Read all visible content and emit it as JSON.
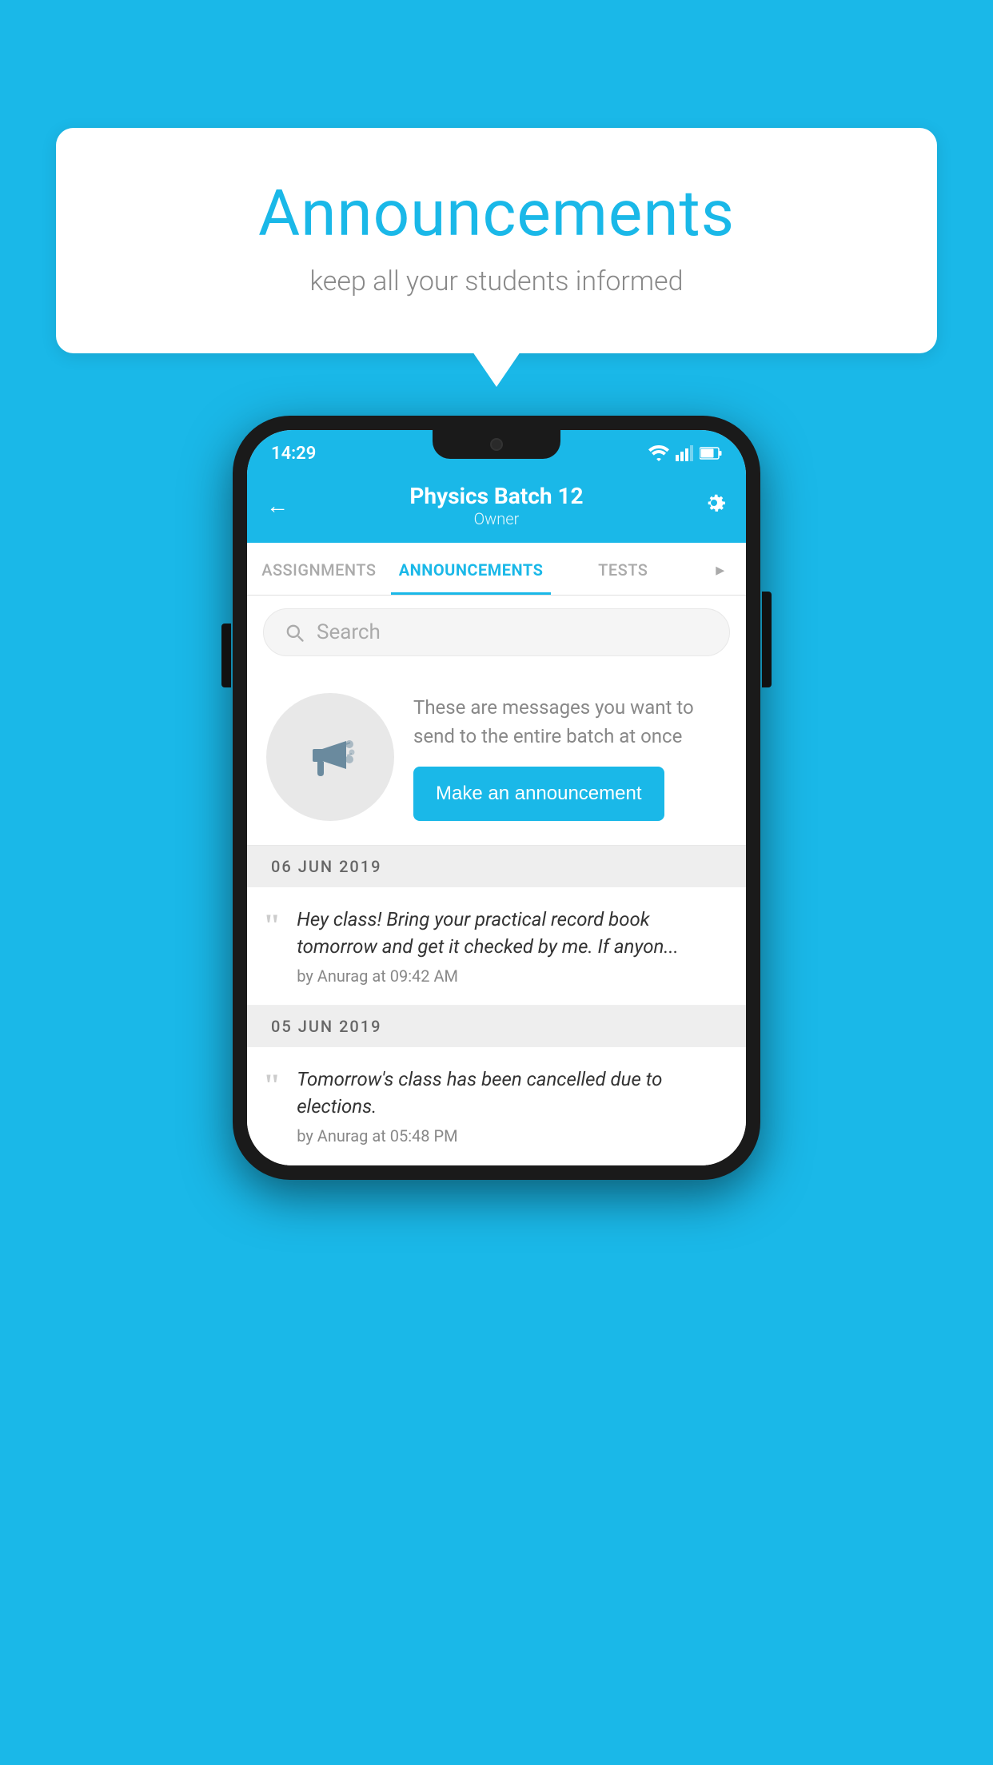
{
  "page": {
    "background_color": "#1ab8e8"
  },
  "speech_bubble": {
    "title": "Announcements",
    "subtitle": "keep all your students informed"
  },
  "status_bar": {
    "time": "14:29",
    "icons": [
      "wifi",
      "signal",
      "battery"
    ]
  },
  "app_header": {
    "title": "Physics Batch 12",
    "subtitle": "Owner",
    "back_label": "←",
    "gear_label": "⚙"
  },
  "tabs": [
    {
      "label": "ASSIGNMENTS",
      "active": false
    },
    {
      "label": "ANNOUNCEMENTS",
      "active": true
    },
    {
      "label": "TESTS",
      "active": false
    },
    {
      "label": "...",
      "active": false
    }
  ],
  "search": {
    "placeholder": "Search"
  },
  "promo": {
    "description": "These are messages you want to send to the entire batch at once",
    "button_label": "Make an announcement"
  },
  "announcements": [
    {
      "date": "06  JUN  2019",
      "text": "Hey class! Bring your practical record book tomorrow and get it checked by me. If anyon...",
      "meta": "by Anurag at 09:42 AM"
    },
    {
      "date": "05  JUN  2019",
      "text": "Tomorrow's class has been cancelled due to elections.",
      "meta": "by Anurag at 05:48 PM"
    }
  ]
}
